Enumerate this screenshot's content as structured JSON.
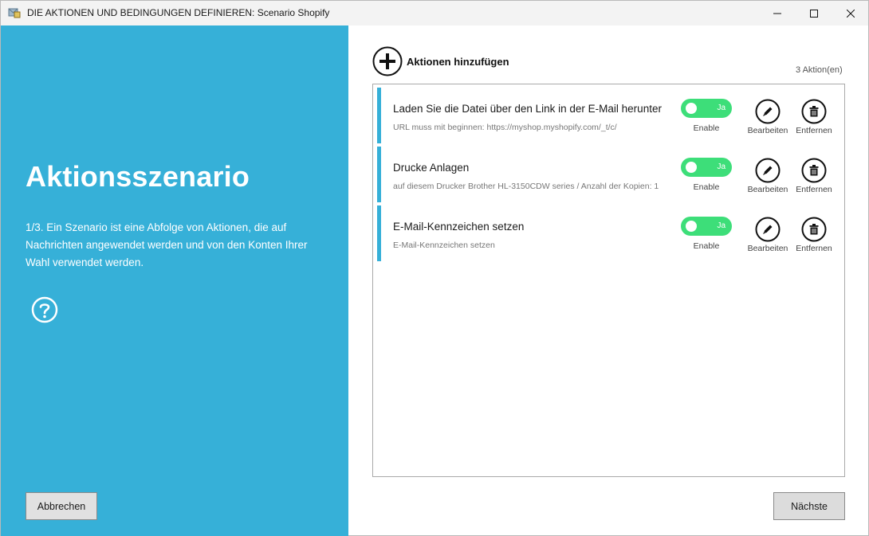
{
  "window": {
    "title": "DIE AKTIONEN UND BEDINGUNGEN DEFINIEREN: Scenario Shopify"
  },
  "left": {
    "heading": "Aktionsszenario",
    "description": "1/3. Ein Szenario ist eine Abfolge von Aktionen, die auf Nachrichten angewendet werden und von den Konten Ihrer Wahl verwendet werden.",
    "cancel_label": "Abbrechen",
    "accent_color": "#36b0d8"
  },
  "right": {
    "add_label": "Aktionen hinzufügen",
    "count_label": "3  Aktion(en)",
    "next_label": "Nächste"
  },
  "actions": [
    {
      "title": "Laden Sie die Datei über den Link in der E-Mail herunter",
      "subtitle": "URL muss mit beginnen: https://myshop.myshopify.com/_t/c/",
      "toggle_text": "Ja",
      "toggle_label": "Enable",
      "edit_label": "Bearbeiten",
      "delete_label": "Entfernen",
      "enabled": true
    },
    {
      "title": "Drucke Anlagen",
      "subtitle": "auf diesem Drucker Brother HL-3150CDW series / Anzahl der Kopien: 1",
      "toggle_text": "Ja",
      "toggle_label": "Enable",
      "edit_label": "Bearbeiten",
      "delete_label": "Entfernen",
      "enabled": true
    },
    {
      "title": "E-Mail-Kennzeichen setzen",
      "subtitle": "E-Mail-Kennzeichen setzen",
      "toggle_text": "Ja",
      "toggle_label": "Enable",
      "edit_label": "Bearbeiten",
      "delete_label": "Entfernen",
      "enabled": true
    }
  ],
  "colors": {
    "toggle_on": "#3dde79",
    "panel": "#36b0d8"
  }
}
